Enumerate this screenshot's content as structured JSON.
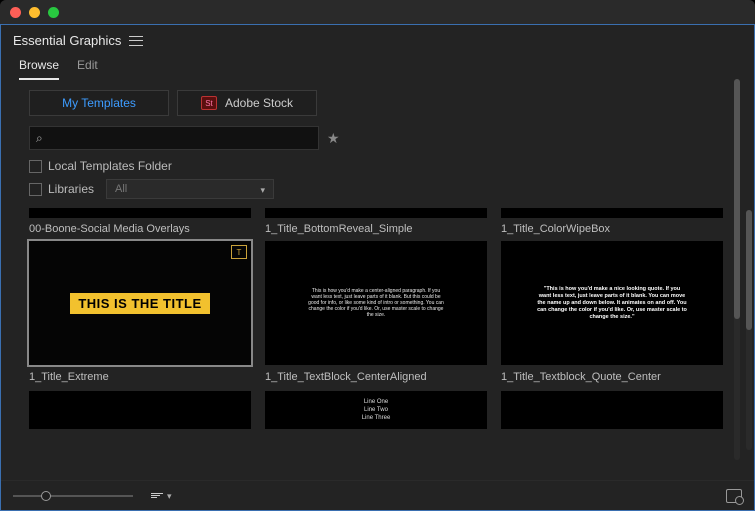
{
  "panel": {
    "title": "Essential Graphics"
  },
  "tabs": {
    "browse": "Browse",
    "edit": "Edit",
    "active": "browse"
  },
  "subtabs": {
    "my_templates": "My Templates",
    "adobe_stock": "Adobe Stock",
    "stock_badge": "St",
    "active": "my_templates"
  },
  "search": {
    "value": "",
    "placeholder": ""
  },
  "options": {
    "local_folder_label": "Local Templates Folder",
    "local_folder_checked": false,
    "libraries_label": "Libraries",
    "libraries_checked": false,
    "libraries_filter": "All"
  },
  "sections": [
    {
      "label": "00-Boone-Social Media Overlays"
    },
    {
      "label": "1_Title_BottomReveal_Simple"
    },
    {
      "label": "1_Title_ColorWipeBox"
    }
  ],
  "items": [
    {
      "label": "1_Title_Extreme",
      "selected": true,
      "kind": "yellow-title",
      "content": "THIS IS THE TITLE",
      "badge": "T"
    },
    {
      "label": "1_Title_TextBlock_CenterAligned",
      "kind": "center-paragraph",
      "content": "This is how you'd make a center-aligned paragraph. If you want less text, just leave parts of it blank. But this could be good for info, or like some kind of intro or something. You can change the color if you'd like. Or, use master scale to change the size."
    },
    {
      "label": "1_Title_Textblock_Quote_Center",
      "kind": "quote",
      "content": "\"This is how you'd make a nice looking quote. If you want less text, just leave parts of it blank. You can move the name up and down below. It animates on and off. You can change the color if you'd like. Or, use master scale to change the size.\""
    }
  ],
  "partial_items": [
    {
      "kind": "blank"
    },
    {
      "kind": "lines",
      "lines": [
        "Line One",
        "Line Two",
        "Line Three"
      ]
    },
    {
      "kind": "blank"
    }
  ],
  "footer": {
    "zoom_pct": 24
  }
}
